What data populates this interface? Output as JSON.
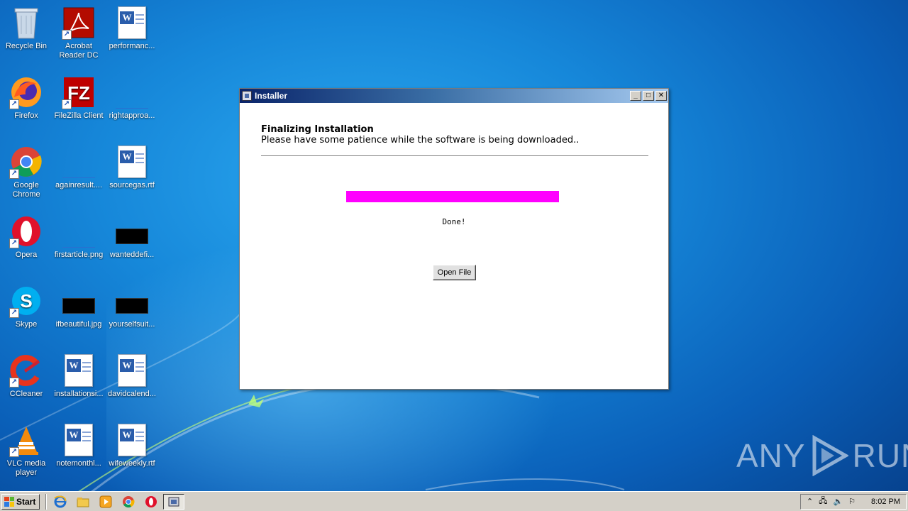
{
  "desktop": {
    "icons": [
      {
        "label": "Recycle Bin"
      },
      {
        "label": "Acrobat Reader DC"
      },
      {
        "label": "performanc..."
      },
      {
        "label": "Firefox"
      },
      {
        "label": "FileZilla Client"
      },
      {
        "label": "rightapproa..."
      },
      {
        "label": "Google Chrome"
      },
      {
        "label": "againresult...."
      },
      {
        "label": "sourcegas.rtf"
      },
      {
        "label": "Opera"
      },
      {
        "label": "firstarticle.png"
      },
      {
        "label": "wanteddefi..."
      },
      {
        "label": "Skype"
      },
      {
        "label": "ifbeautiful.jpg"
      },
      {
        "label": "yourselfsuit..."
      },
      {
        "label": "CCleaner"
      },
      {
        "label": "installationsi..."
      },
      {
        "label": "davidcalend..."
      },
      {
        "label": "VLC media player"
      },
      {
        "label": "notemonthl..."
      },
      {
        "label": "wifeweekly.rtf"
      }
    ]
  },
  "installer": {
    "title": "Installer",
    "heading": "Finalizing Installation",
    "subheading": "Please have some patience while the software is being downloaded..",
    "progress_percent": 100,
    "progress_color": "#ff00ff",
    "status": "Done!",
    "open_button": "Open File"
  },
  "watermark": {
    "left": "ANY",
    "right": "RUN"
  },
  "taskbar": {
    "start_label": "Start",
    "clock": "8:02 PM"
  }
}
